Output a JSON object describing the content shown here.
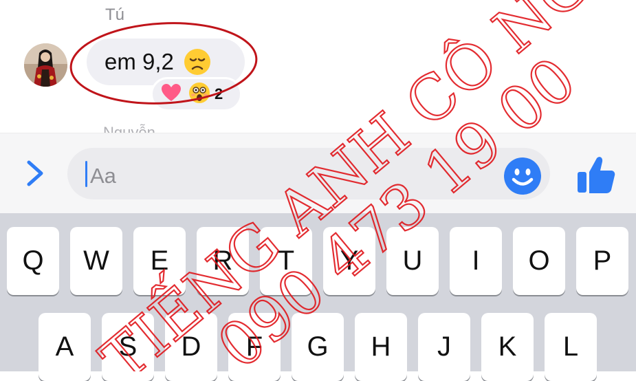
{
  "chat": {
    "sender_name": "Tú",
    "message_text": "em 9,2",
    "message_emoji": "disappointed-face",
    "reactions": {
      "emojis": [
        "heart",
        "astonished-face"
      ],
      "count": "2"
    },
    "next_sender_name": "Nguyễn"
  },
  "composer": {
    "expand_icon": "chevron-right-icon",
    "placeholder": "Aa",
    "emoji_icon": "smiley-icon",
    "like_icon": "thumbs-up-icon",
    "accent_color": "#2f7df6"
  },
  "keyboard": {
    "row1": [
      "Q",
      "W",
      "E",
      "R",
      "T",
      "Y",
      "U",
      "I",
      "O",
      "P"
    ],
    "row2": [
      "A",
      "S",
      "D",
      "F",
      "G",
      "H",
      "J",
      "K",
      "L"
    ]
  },
  "watermark": {
    "line1": "TIẾNG ANH CÔ NGA",
    "line2": "090 473 19 00",
    "color": "#e0161b"
  }
}
